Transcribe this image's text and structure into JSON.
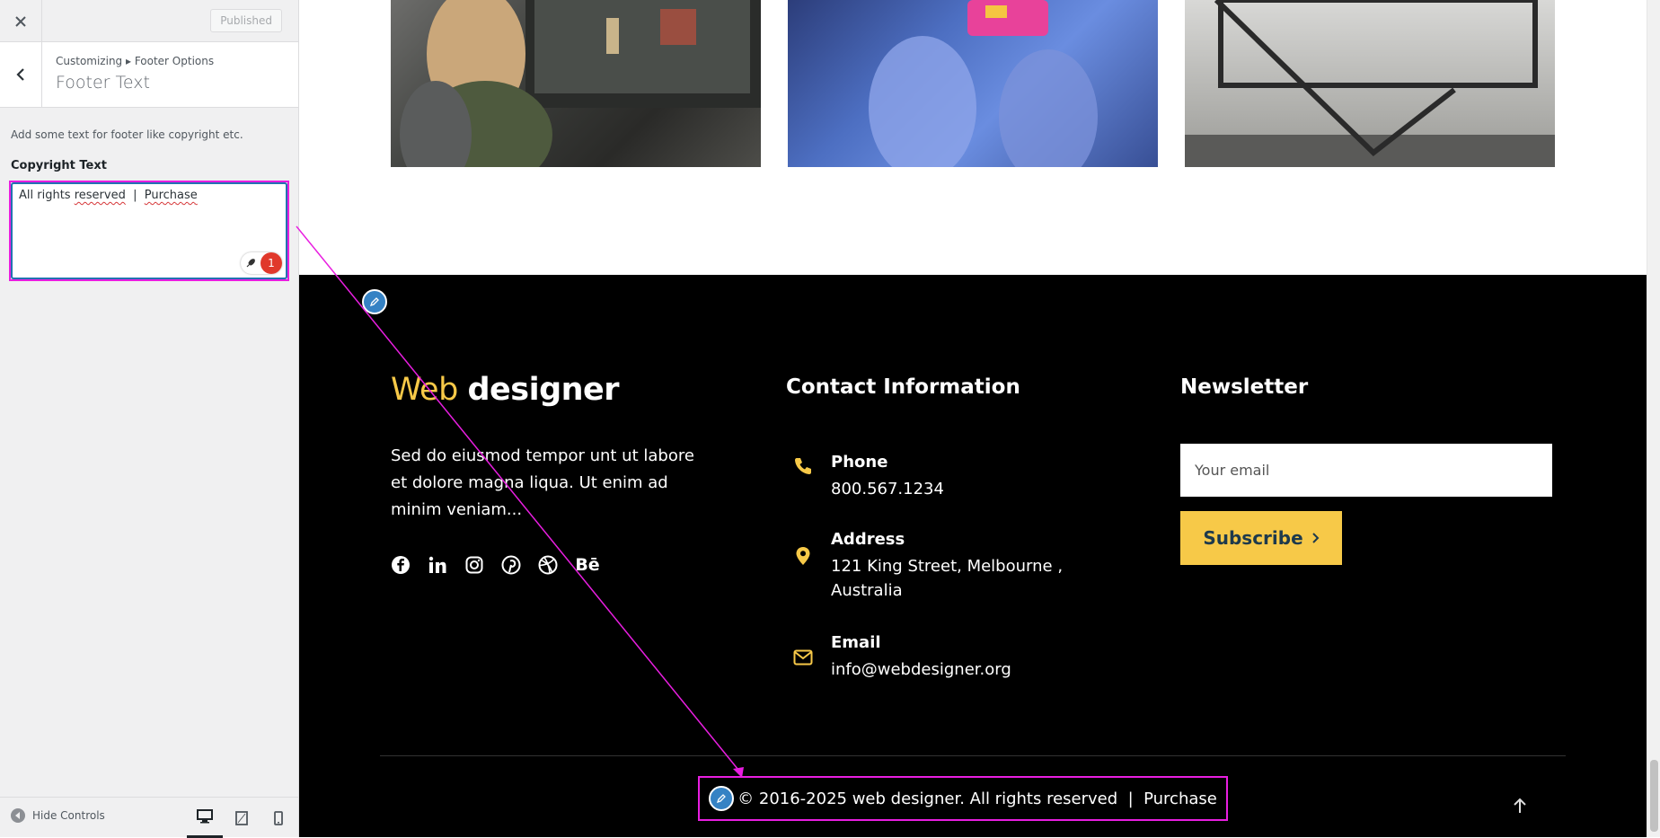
{
  "customizer": {
    "published_label": "Published",
    "breadcrumb": "Customizing ▸ Footer Options",
    "section_title": "Footer Text",
    "description": "Add some text for footer like copyright etc.",
    "field_label": "Copyright Text",
    "textarea": {
      "part1": "All rights ",
      "part2": "reserved",
      "part3": "  |  ",
      "part4": "Purchase"
    },
    "grammar_count": "1",
    "hide_controls_label": "Hide Controls",
    "icons": {
      "close": "close-icon",
      "back": "chevron-left-icon",
      "hide": "arrow-left-circle-icon",
      "desktop": "desktop-icon",
      "tablet": "tablet-icon",
      "mobile": "mobile-icon"
    }
  },
  "footer": {
    "brand_part1": "Web",
    "brand_part2": "designer",
    "about": "Sed do eiusmod tempor unt ut labore et dolore magna liqua. Ut enim ad minim veniam...",
    "socials": [
      "facebook-icon",
      "linkedin-icon",
      "instagram-icon",
      "pinterest-icon",
      "dribbble-icon",
      "behance-icon"
    ],
    "behance_text": "Bē",
    "contact_title": "Contact Information",
    "contact": {
      "phone_label": "Phone",
      "phone_value": "800.567.1234",
      "address_label": "Address",
      "address_value": "121 King Street, Melbourne , Australia",
      "email_label": "Email",
      "email_value": "info@webdesigner.org"
    },
    "newsletter_title": "Newsletter",
    "email_placeholder": "Your email",
    "subscribe_label": "Subscribe",
    "copyright": "© 2016-2025 web designer. All rights reserved  |  Purchase"
  },
  "colors": {
    "accent": "#f7c948",
    "highlight": "#e81ee0",
    "edit_shortcut": "#3582c4"
  }
}
